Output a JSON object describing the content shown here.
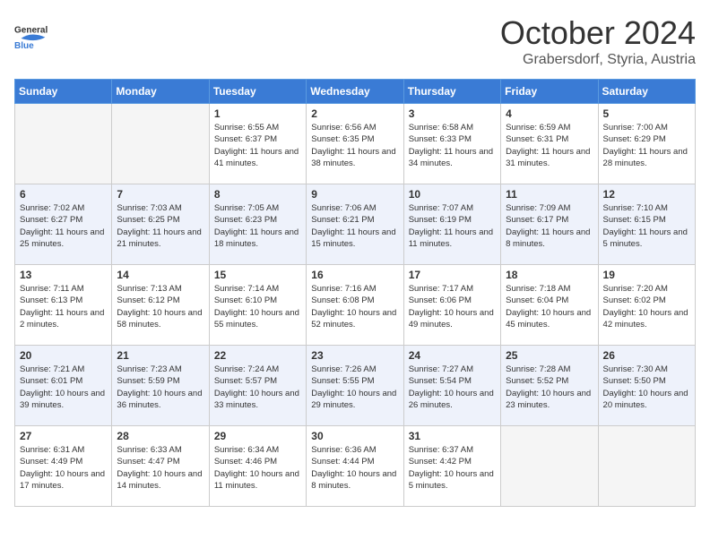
{
  "header": {
    "logo_general": "General",
    "logo_blue": "Blue",
    "month": "October 2024",
    "location": "Grabersdorf, Styria, Austria"
  },
  "days_of_week": [
    "Sunday",
    "Monday",
    "Tuesday",
    "Wednesday",
    "Thursday",
    "Friday",
    "Saturday"
  ],
  "weeks": [
    [
      {
        "day": "",
        "sunrise": "",
        "sunset": "",
        "daylight": ""
      },
      {
        "day": "",
        "sunrise": "",
        "sunset": "",
        "daylight": ""
      },
      {
        "day": "1",
        "sunrise": "Sunrise: 6:55 AM",
        "sunset": "Sunset: 6:37 PM",
        "daylight": "Daylight: 11 hours and 41 minutes."
      },
      {
        "day": "2",
        "sunrise": "Sunrise: 6:56 AM",
        "sunset": "Sunset: 6:35 PM",
        "daylight": "Daylight: 11 hours and 38 minutes."
      },
      {
        "day": "3",
        "sunrise": "Sunrise: 6:58 AM",
        "sunset": "Sunset: 6:33 PM",
        "daylight": "Daylight: 11 hours and 34 minutes."
      },
      {
        "day": "4",
        "sunrise": "Sunrise: 6:59 AM",
        "sunset": "Sunset: 6:31 PM",
        "daylight": "Daylight: 11 hours and 31 minutes."
      },
      {
        "day": "5",
        "sunrise": "Sunrise: 7:00 AM",
        "sunset": "Sunset: 6:29 PM",
        "daylight": "Daylight: 11 hours and 28 minutes."
      }
    ],
    [
      {
        "day": "6",
        "sunrise": "Sunrise: 7:02 AM",
        "sunset": "Sunset: 6:27 PM",
        "daylight": "Daylight: 11 hours and 25 minutes."
      },
      {
        "day": "7",
        "sunrise": "Sunrise: 7:03 AM",
        "sunset": "Sunset: 6:25 PM",
        "daylight": "Daylight: 11 hours and 21 minutes."
      },
      {
        "day": "8",
        "sunrise": "Sunrise: 7:05 AM",
        "sunset": "Sunset: 6:23 PM",
        "daylight": "Daylight: 11 hours and 18 minutes."
      },
      {
        "day": "9",
        "sunrise": "Sunrise: 7:06 AM",
        "sunset": "Sunset: 6:21 PM",
        "daylight": "Daylight: 11 hours and 15 minutes."
      },
      {
        "day": "10",
        "sunrise": "Sunrise: 7:07 AM",
        "sunset": "Sunset: 6:19 PM",
        "daylight": "Daylight: 11 hours and 11 minutes."
      },
      {
        "day": "11",
        "sunrise": "Sunrise: 7:09 AM",
        "sunset": "Sunset: 6:17 PM",
        "daylight": "Daylight: 11 hours and 8 minutes."
      },
      {
        "day": "12",
        "sunrise": "Sunrise: 7:10 AM",
        "sunset": "Sunset: 6:15 PM",
        "daylight": "Daylight: 11 hours and 5 minutes."
      }
    ],
    [
      {
        "day": "13",
        "sunrise": "Sunrise: 7:11 AM",
        "sunset": "Sunset: 6:13 PM",
        "daylight": "Daylight: 11 hours and 2 minutes."
      },
      {
        "day": "14",
        "sunrise": "Sunrise: 7:13 AM",
        "sunset": "Sunset: 6:12 PM",
        "daylight": "Daylight: 10 hours and 58 minutes."
      },
      {
        "day": "15",
        "sunrise": "Sunrise: 7:14 AM",
        "sunset": "Sunset: 6:10 PM",
        "daylight": "Daylight: 10 hours and 55 minutes."
      },
      {
        "day": "16",
        "sunrise": "Sunrise: 7:16 AM",
        "sunset": "Sunset: 6:08 PM",
        "daylight": "Daylight: 10 hours and 52 minutes."
      },
      {
        "day": "17",
        "sunrise": "Sunrise: 7:17 AM",
        "sunset": "Sunset: 6:06 PM",
        "daylight": "Daylight: 10 hours and 49 minutes."
      },
      {
        "day": "18",
        "sunrise": "Sunrise: 7:18 AM",
        "sunset": "Sunset: 6:04 PM",
        "daylight": "Daylight: 10 hours and 45 minutes."
      },
      {
        "day": "19",
        "sunrise": "Sunrise: 7:20 AM",
        "sunset": "Sunset: 6:02 PM",
        "daylight": "Daylight: 10 hours and 42 minutes."
      }
    ],
    [
      {
        "day": "20",
        "sunrise": "Sunrise: 7:21 AM",
        "sunset": "Sunset: 6:01 PM",
        "daylight": "Daylight: 10 hours and 39 minutes."
      },
      {
        "day": "21",
        "sunrise": "Sunrise: 7:23 AM",
        "sunset": "Sunset: 5:59 PM",
        "daylight": "Daylight: 10 hours and 36 minutes."
      },
      {
        "day": "22",
        "sunrise": "Sunrise: 7:24 AM",
        "sunset": "Sunset: 5:57 PM",
        "daylight": "Daylight: 10 hours and 33 minutes."
      },
      {
        "day": "23",
        "sunrise": "Sunrise: 7:26 AM",
        "sunset": "Sunset: 5:55 PM",
        "daylight": "Daylight: 10 hours and 29 minutes."
      },
      {
        "day": "24",
        "sunrise": "Sunrise: 7:27 AM",
        "sunset": "Sunset: 5:54 PM",
        "daylight": "Daylight: 10 hours and 26 minutes."
      },
      {
        "day": "25",
        "sunrise": "Sunrise: 7:28 AM",
        "sunset": "Sunset: 5:52 PM",
        "daylight": "Daylight: 10 hours and 23 minutes."
      },
      {
        "day": "26",
        "sunrise": "Sunrise: 7:30 AM",
        "sunset": "Sunset: 5:50 PM",
        "daylight": "Daylight: 10 hours and 20 minutes."
      }
    ],
    [
      {
        "day": "27",
        "sunrise": "Sunrise: 6:31 AM",
        "sunset": "Sunset: 4:49 PM",
        "daylight": "Daylight: 10 hours and 17 minutes."
      },
      {
        "day": "28",
        "sunrise": "Sunrise: 6:33 AM",
        "sunset": "Sunset: 4:47 PM",
        "daylight": "Daylight: 10 hours and 14 minutes."
      },
      {
        "day": "29",
        "sunrise": "Sunrise: 6:34 AM",
        "sunset": "Sunset: 4:46 PM",
        "daylight": "Daylight: 10 hours and 11 minutes."
      },
      {
        "day": "30",
        "sunrise": "Sunrise: 6:36 AM",
        "sunset": "Sunset: 4:44 PM",
        "daylight": "Daylight: 10 hours and 8 minutes."
      },
      {
        "day": "31",
        "sunrise": "Sunrise: 6:37 AM",
        "sunset": "Sunset: 4:42 PM",
        "daylight": "Daylight: 10 hours and 5 minutes."
      },
      {
        "day": "",
        "sunrise": "",
        "sunset": "",
        "daylight": ""
      },
      {
        "day": "",
        "sunrise": "",
        "sunset": "",
        "daylight": ""
      }
    ]
  ]
}
